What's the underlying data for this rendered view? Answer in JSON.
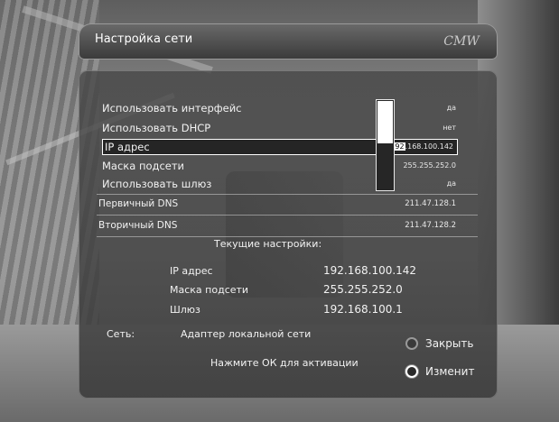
{
  "header": {
    "title": "Настройка сети",
    "logo": "CMW"
  },
  "settings": [
    {
      "label": "Использовать интерфейс",
      "value": "да"
    },
    {
      "label": "Использовать DHCP",
      "value": "нет"
    },
    {
      "label": "IP адрес",
      "value_highlight": "192",
      "value_rest": ".168.100.142"
    },
    {
      "label": "Маска подсети",
      "value": "255.255.252.0"
    },
    {
      "label": "Использовать шлюз",
      "value": "да"
    }
  ],
  "dns": [
    {
      "label": "Первичный DNS",
      "value": "211.47.128.1"
    },
    {
      "label": "Вторичный DNS",
      "value": "211.47.128.2"
    }
  ],
  "scrollbar": {
    "position": 0.5
  },
  "current": {
    "title": "Текущие настройки:",
    "rows": [
      {
        "label": "IP адрес",
        "value": "192.168.100.142"
      },
      {
        "label": "Маска подсети",
        "value": "255.255.252.0"
      },
      {
        "label": "Шлюз",
        "value": "192.168.100.1"
      }
    ]
  },
  "network": {
    "label": "Сеть:",
    "value": "Адаптер локальной сети"
  },
  "hint": "Нажмите ОК для активации",
  "buttons": {
    "close": "Закрыть",
    "change": "Изменит"
  }
}
